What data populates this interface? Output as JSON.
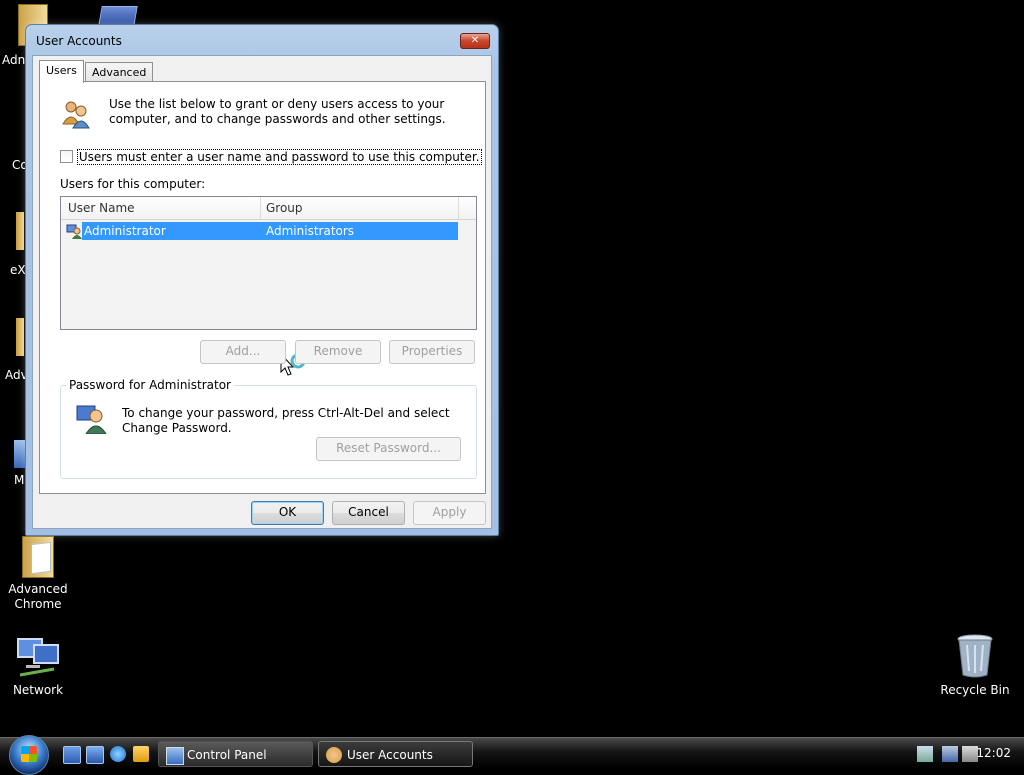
{
  "desktop": {
    "icons": {
      "chrome_label": "Advanced Chrome",
      "network_label": "Network",
      "recycle_label": "Recycle Bin"
    },
    "partial_labels": [
      "Adn",
      "Co",
      "eX",
      "Adv",
      "M"
    ]
  },
  "window": {
    "title": "User Accounts",
    "close_glyph": "✕",
    "tabs": [
      {
        "label": "Users",
        "active": true
      },
      {
        "label": "Advanced",
        "active": false
      }
    ],
    "intro": "Use the list below to grant or deny users access to your computer, and to change passwords and other settings.",
    "checkbox_label": "Users must enter a user name and password to use this computer.",
    "checkbox_checked": false,
    "users_label": "Users for this computer:",
    "list": {
      "columns": [
        "User Name",
        "Group"
      ],
      "rows": [
        {
          "user": "Administrator",
          "group": "Administrators",
          "selected": true
        }
      ]
    },
    "buttons": {
      "add": "Add...",
      "remove": "Remove",
      "properties": "Properties",
      "reset_password": "Reset Password...",
      "ok": "OK",
      "cancel": "Cancel",
      "apply": "Apply"
    },
    "password_group": {
      "title": "Password for Administrator",
      "text": "To change your password, press Ctrl-Alt-Del and select Change Password."
    }
  },
  "taskbar": {
    "buttons": [
      {
        "label": "Control Panel",
        "active": false
      },
      {
        "label": "User Accounts",
        "active": true
      }
    ],
    "clock": "12:02"
  },
  "colors": {
    "selection": "#3399ff",
    "desktop": "#000000",
    "close_button": "#c7452b"
  }
}
